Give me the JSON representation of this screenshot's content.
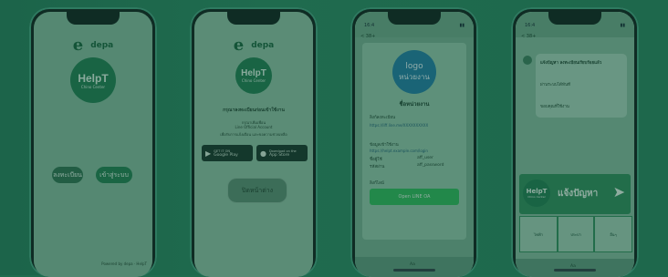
{
  "phone1": {
    "logo_mark": "e",
    "depa": "depa",
    "helpt_title": "HelpT",
    "helpt_sub": "Chino Center",
    "btn_register": "ลงทะเบียน",
    "btn_login": "เข้าสู่ระบบ",
    "footer": "Powered by depa · HelpT"
  },
  "phone2": {
    "logo_mark": "e",
    "depa": "depa",
    "helpt_title": "HelpT",
    "helpt_sub": "Chino Center",
    "heading": "กรุณาลงทะเบียนก่อนเข้าใช้งาน",
    "line_notice": "กรุณาเพิ่มเพื่อน",
    "line_oa": "Line Official Account",
    "line_desc": "เพื่อรับการแจ้งเตือน และขอความช่วยเหลือ",
    "google_play_small": "GET IT ON",
    "google_play": "Google Play",
    "app_store_small": "Download on the",
    "app_store": "App Store",
    "btn_back": "ปิดหน้าต่าง"
  },
  "phone3": {
    "status_time": "16:4",
    "back_label": "< 38+",
    "logo_line1": "logo",
    "logo_line2": "หน่วยงาน",
    "agency_name": "ชื่อหน่วยงาน",
    "url_label": "ลิงก์ลงทะเบียน",
    "url": "https://liff.line.me/XXXXXXXXXX",
    "info_label": "ข้อมูลเข้าใช้งาน",
    "info_url": "https://helpt.example.com/login",
    "user_label": "ชื่อผู้ใช้",
    "user_val": "aff_user",
    "pass_label": "รหัสผ่าน",
    "pass_val": "aff_password",
    "section": "ลิงก์ไลน์",
    "open_button": "Open LINE OA",
    "input_placeholder": "Aa"
  },
  "phone4": {
    "status_time": "16:4",
    "back_label": "< 38+",
    "msg1": "แจ้งปัญหา ลงทะเบียนเรียบร้อยแล้ว",
    "msg2": "ผ่านระบบได้ทันที",
    "msg3": "ขอบคุณที่ใช้งาน",
    "banner_brand": "HelpT",
    "banner_sub": "Chino Center",
    "banner_title": "แจ้งปัญหา",
    "cell1": "ไฟฟ้า",
    "cell2": "ประปา",
    "cell3": "อื่นๆ",
    "input_placeholder": "Aa"
  },
  "colors": {
    "background": "#1f6b4e",
    "brand_green": "#1e7a52",
    "line_green": "#2eb85c"
  }
}
